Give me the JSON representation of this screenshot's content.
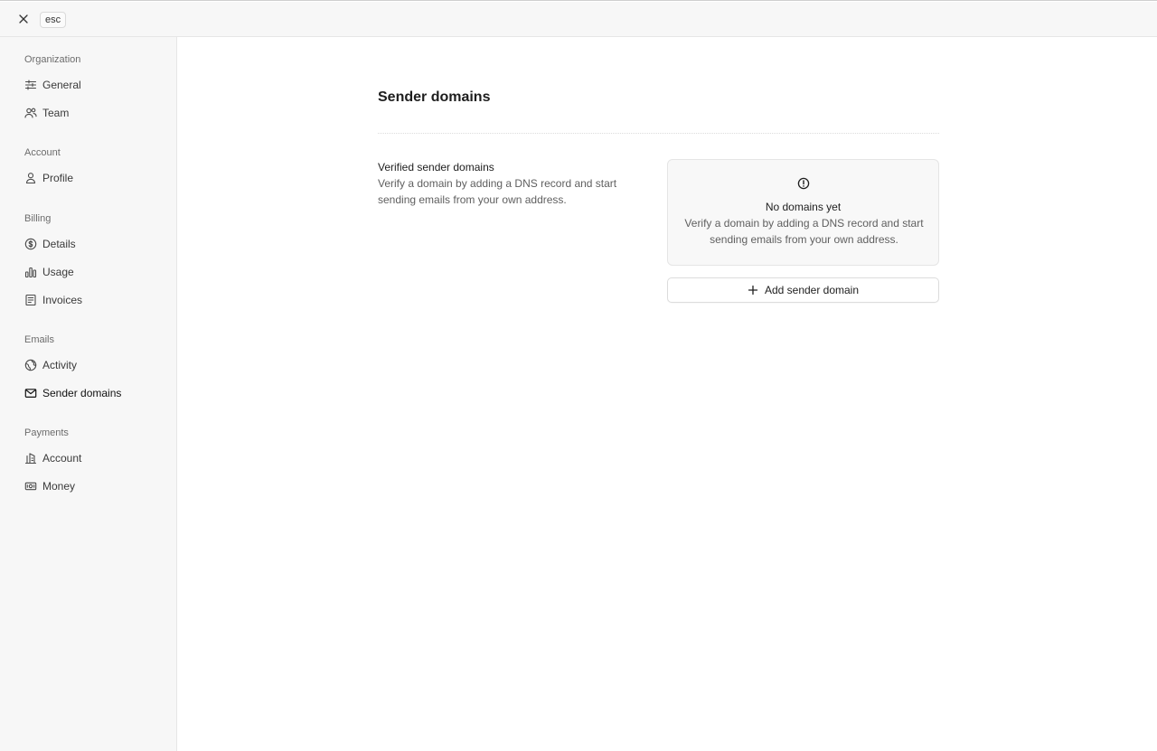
{
  "topbar": {
    "close_icon": "close-icon",
    "esc_label": "esc"
  },
  "sidebar": {
    "groups": [
      {
        "label": "Organization",
        "items": [
          {
            "label": "General",
            "icon": "sliders-icon"
          },
          {
            "label": "Team",
            "icon": "users-icon"
          }
        ]
      },
      {
        "label": "Account",
        "items": [
          {
            "label": "Profile",
            "icon": "user-icon"
          }
        ]
      },
      {
        "label": "Billing",
        "items": [
          {
            "label": "Details",
            "icon": "dollar-circle-icon"
          },
          {
            "label": "Usage",
            "icon": "bar-chart-icon"
          },
          {
            "label": "Invoices",
            "icon": "receipt-icon"
          }
        ]
      },
      {
        "label": "Emails",
        "items": [
          {
            "label": "Activity",
            "icon": "globe-icon"
          },
          {
            "label": "Sender domains",
            "icon": "mail-icon",
            "active": true
          }
        ]
      },
      {
        "label": "Payments",
        "items": [
          {
            "label": "Account",
            "icon": "bank-icon"
          },
          {
            "label": "Money",
            "icon": "banknote-icon"
          }
        ]
      }
    ]
  },
  "main": {
    "title": "Sender domains",
    "section": {
      "title": "Verified sender domains",
      "description": "Verify a domain by adding a DNS record and start sending emails from your own address."
    },
    "empty_state": {
      "icon": "alert-circle-icon",
      "title": "No domains yet",
      "description": "Verify a domain by adding a DNS record and start sending emails from your own address."
    },
    "add_button": {
      "icon": "plus-icon",
      "label": "Add sender domain"
    }
  },
  "colors": {
    "sidebar_bg": "#f7f7f7",
    "card_bg": "#f8f8f8",
    "text_primary": "#1e1e1e",
    "text_muted": "#5f5f5f"
  }
}
